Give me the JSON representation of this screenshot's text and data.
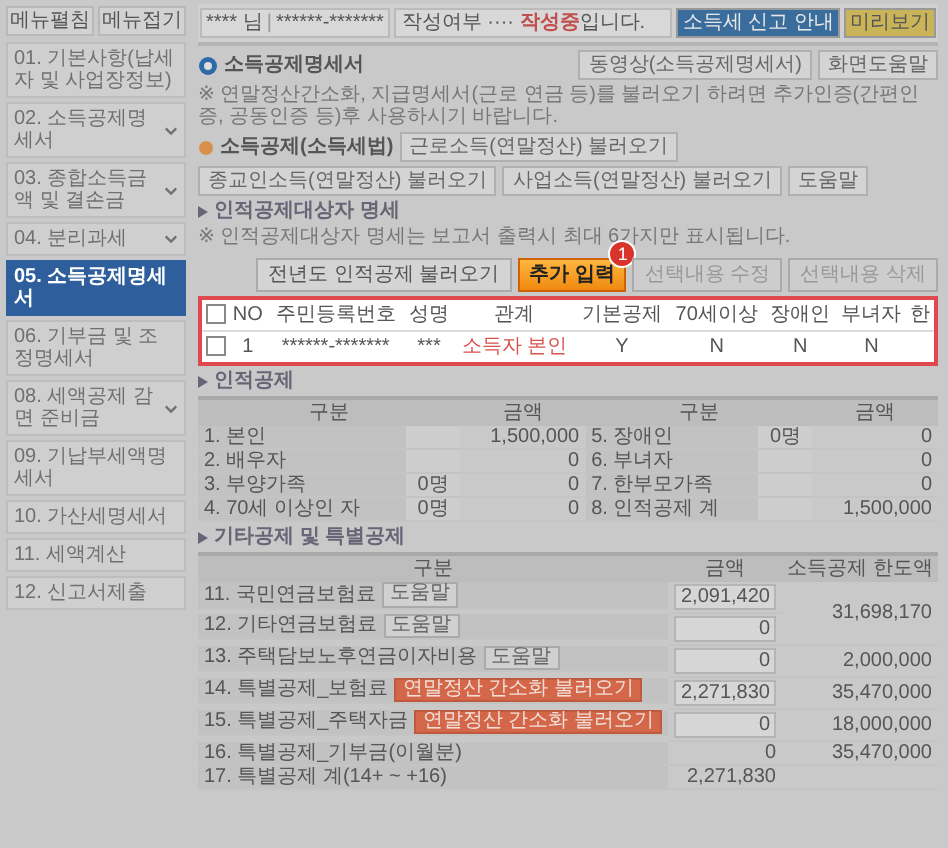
{
  "sidebar": {
    "buttons": [
      "메뉴펼침",
      "메뉴접기"
    ],
    "items": [
      {
        "label": "01. 기본사항(납세자 및 사업장정보)",
        "selected": false,
        "has_submenu": false
      },
      {
        "label": "02. 소득공제명세서",
        "selected": false,
        "has_submenu": true
      },
      {
        "label": "03. 종합소득금액 및 결손금",
        "selected": false,
        "has_submenu": true
      },
      {
        "label": "04. 분리과세",
        "selected": false,
        "has_submenu": true
      },
      {
        "label": "05. 소득공제명세서",
        "selected": true,
        "has_submenu": false
      },
      {
        "label": "06. 기부금 및 조정명세서",
        "selected": false,
        "has_submenu": false
      },
      {
        "label": "08. 세액공제 감면 준비금",
        "selected": false,
        "has_submenu": true
      },
      {
        "label": "09. 기납부세액명세서",
        "selected": false,
        "has_submenu": false
      },
      {
        "label": "10. 가산세명세서",
        "selected": false,
        "has_submenu": false
      },
      {
        "label": "11. 세액계산",
        "selected": false,
        "has_submenu": false
      },
      {
        "label": "12. 신고서제출",
        "selected": false,
        "has_submenu": false
      }
    ]
  },
  "header": {
    "user": "**** 님",
    "separator": "|",
    "id": "******-*******",
    "status_label": "작성여부",
    "status_dots": "····",
    "status": "작성중",
    "status_suffix": "입니다.",
    "buttons": [
      {
        "label": "소득세 신고 안내",
        "kind": "info"
      },
      {
        "label": "미리보기",
        "kind": "preview"
      }
    ]
  },
  "title": "소득공제명세서",
  "title_buttons": [
    "동영상(소득공제명세서)",
    "화면도움말"
  ],
  "notice": "※ 연말정산간소화, 지급명세서(근로 연금 등)를 불러오기 하려면 추가인증(간편인증, 공동인증 등)후 사용하시기 바랍니다.",
  "deduction": {
    "label": "소득공제(소득세법)",
    "buttons": [
      "근로소득(연말정산) 불러오기",
      "종교인소득(연말정산) 불러오기",
      "사업소득(연말정산) 불러오기",
      "도움말"
    ]
  },
  "dependents": {
    "title": "인적공제대상자 명세",
    "note": "※ 인적공제대상자 명세는 보고서 출력시 최대 6가지만 표시됩니다.",
    "actions": [
      {
        "label": "전년도 인적공제 불러오기",
        "kind": "default"
      },
      {
        "label": "추가 입력",
        "kind": "primary",
        "badge": "1"
      },
      {
        "label": "선택내용 수정",
        "kind": "outline"
      },
      {
        "label": "선택내용 삭제",
        "kind": "outline"
      }
    ],
    "table": {
      "highlighted": true,
      "header_checked": false,
      "columns": [
        "NO",
        "주민등록번호",
        "성명",
        "관계",
        "기본공제",
        "70세이상",
        "장애인",
        "부녀자",
        "한"
      ],
      "rows": [
        {
          "checked": false,
          "cells": [
            "1",
            "******-*******",
            "***",
            "소득자 본인",
            "Y",
            "N",
            "N",
            "N"
          ]
        }
      ]
    }
  },
  "personal": {
    "title": "인적공제",
    "columns": [
      "구분",
      "금액",
      "구분",
      "금액"
    ],
    "left": [
      {
        "label": "1. 본인",
        "amount": "1,500,000"
      },
      {
        "label": "2. 배우자",
        "amount": "0"
      },
      {
        "label": "3. 부양가족",
        "count": "0명",
        "amount": "0"
      },
      {
        "label": "4. 70세 이상인 자",
        "count": "0명",
        "amount": "0"
      }
    ],
    "right": [
      {
        "label": "5. 장애인",
        "count": "0명",
        "amount": "0"
      },
      {
        "label": "6. 부녀자",
        "amount": "0"
      },
      {
        "label": "7. 한부모가족",
        "amount": "0"
      },
      {
        "label": "8. 인적공제 계",
        "amount": "1,500,000"
      }
    ]
  },
  "other": {
    "title": "기타공제 및 특별공제",
    "columns": [
      "구분",
      "금액",
      "소득공제 한도액"
    ],
    "rows": [
      {
        "label": "11. 국민연금보험료",
        "button": {
          "label": "도움말",
          "kind": "help"
        },
        "amount": "2,091,420",
        "boxed": true,
        "limit": "31,698,170",
        "limit_shared_with_next": true
      },
      {
        "label": "12. 기타연금보험료",
        "button": {
          "label": "도움말",
          "kind": "help"
        },
        "amount": "0",
        "boxed": true
      },
      {
        "label": "13. 주택담보노후연금이자비용",
        "button": {
          "label": "도움말",
          "kind": "help"
        },
        "amount": "0",
        "boxed": true,
        "limit": "2,000,000"
      },
      {
        "label": "14. 특별공제_보험료",
        "button": {
          "label": "연말정산 간소화 불러오기",
          "kind": "load"
        },
        "amount": "2,271,830",
        "boxed": true,
        "limit": "35,470,000"
      },
      {
        "label": "15. 특별공제_주택자금",
        "button": {
          "label": "연말정산 간소화 불러오기",
          "kind": "load"
        },
        "amount": "0",
        "boxed": true,
        "limit": "18,000,000"
      },
      {
        "label": "16. 특별공제_기부금(이월분)",
        "amount": "0",
        "boxed": false,
        "limit": "35,470,000"
      },
      {
        "label": "17. 특별공제 계(14+ ~ +16)",
        "amount": "2,271,830",
        "boxed": false
      }
    ]
  }
}
